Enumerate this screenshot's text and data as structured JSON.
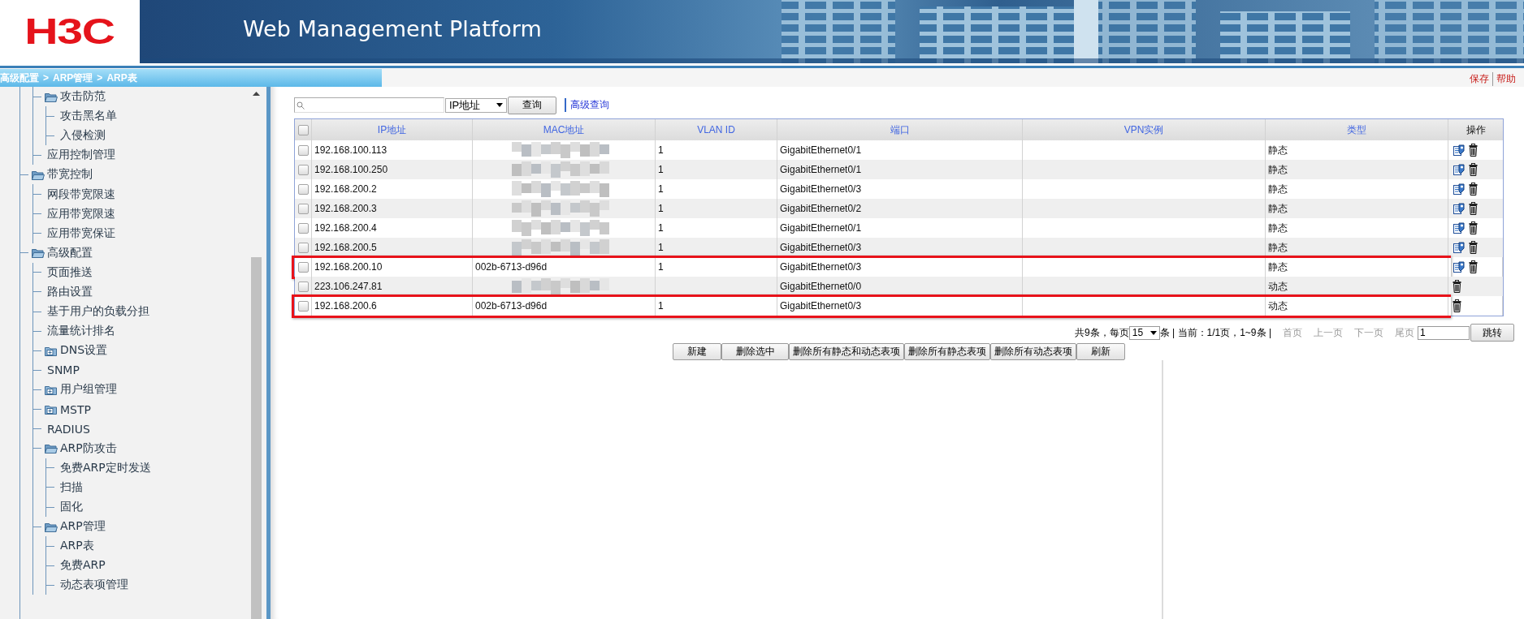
{
  "header": {
    "logo": "H3C",
    "title": "Web Management Platform"
  },
  "breadcrumb": {
    "items": [
      "高级配置",
      "ARP管理",
      "ARP表"
    ],
    "separator": ">"
  },
  "top_links": [
    "保存",
    "帮助"
  ],
  "sidebar": {
    "tree": [
      {
        "kind": "group",
        "children": [
          {
            "label": "攻击防范",
            "kind": "folder",
            "expanded": true,
            "children": [
              {
                "label": "攻击黑名单",
                "kind": "leaf"
              },
              {
                "label": "入侵检测",
                "kind": "leaf"
              }
            ]
          },
          {
            "label": "应用控制管理",
            "kind": "leaf"
          }
        ]
      },
      {
        "label": "带宽控制",
        "kind": "folder",
        "expanded": true,
        "children": [
          {
            "label": "网段带宽限速",
            "kind": "leaf"
          },
          {
            "label": "应用带宽限速",
            "kind": "leaf"
          },
          {
            "label": "应用带宽保证",
            "kind": "leaf"
          }
        ]
      },
      {
        "label": "高级配置",
        "kind": "folder",
        "expanded": true,
        "children": [
          {
            "label": "页面推送",
            "kind": "leaf"
          },
          {
            "label": "路由设置",
            "kind": "leaf"
          },
          {
            "label": "基于用户的负载分担",
            "kind": "leaf"
          },
          {
            "label": "流量统计排名",
            "kind": "leaf"
          },
          {
            "label": "DNS设置",
            "kind": "folder",
            "expanded": false
          },
          {
            "label": "SNMP",
            "kind": "leaf"
          },
          {
            "label": "用户组管理",
            "kind": "folder",
            "expanded": false
          },
          {
            "label": "MSTP",
            "kind": "folder",
            "expanded": false
          },
          {
            "label": "RADIUS",
            "kind": "leaf"
          },
          {
            "label": "ARP防攻击",
            "kind": "folder",
            "expanded": true,
            "children": [
              {
                "label": "免费ARP定时发送",
                "kind": "leaf"
              },
              {
                "label": "扫描",
                "kind": "leaf"
              },
              {
                "label": "固化",
                "kind": "leaf"
              }
            ]
          },
          {
            "label": "ARP管理",
            "kind": "folder",
            "expanded": true,
            "children": [
              {
                "label": "ARP表",
                "kind": "leaf"
              },
              {
                "label": "免费ARP",
                "kind": "leaf"
              },
              {
                "label": "动态表项管理",
                "kind": "leaf"
              }
            ]
          }
        ]
      }
    ]
  },
  "search": {
    "field_type": "IP地址",
    "button": "查询",
    "advanced_link": "高级查询"
  },
  "table": {
    "select_all": {
      "checked": false
    },
    "columns": [
      {
        "label": "IP地址",
        "sortable": true
      },
      {
        "label": "MAC地址",
        "sortable": true
      },
      {
        "label": "VLAN ID",
        "sortable": true
      },
      {
        "label": "端口",
        "sortable": true
      },
      {
        "label": "VPN实例",
        "sortable": true
      },
      {
        "label": "类型",
        "sortable": true
      },
      {
        "label": "操作",
        "sortable": false
      }
    ],
    "rows": [
      {
        "checked": false,
        "ip": "192.168.100.113",
        "mac_redacted": true,
        "vlan": "1",
        "port": "GigabitEthernet0/1",
        "type": "静态",
        "actions": [
          {
            "kind": "edit"
          },
          {
            "kind": "delete"
          }
        ],
        "highlighted": false
      },
      {
        "checked": false,
        "ip": "192.168.100.250",
        "mac_redacted": true,
        "vlan": "1",
        "port": "GigabitEthernet0/1",
        "type": "静态",
        "actions": [
          {
            "kind": "edit"
          },
          {
            "kind": "delete"
          }
        ],
        "highlighted": false
      },
      {
        "checked": false,
        "ip": "192.168.200.2",
        "mac_redacted": true,
        "vlan": "1",
        "port": "GigabitEthernet0/3",
        "type": "静态",
        "actions": [
          {
            "kind": "edit"
          },
          {
            "kind": "delete"
          }
        ],
        "highlighted": false
      },
      {
        "checked": false,
        "ip": "192.168.200.3",
        "mac_redacted": true,
        "vlan": "1",
        "port": "GigabitEthernet0/2",
        "type": "静态",
        "actions": [
          {
            "kind": "edit"
          },
          {
            "kind": "delete"
          }
        ],
        "highlighted": false
      },
      {
        "checked": false,
        "ip": "192.168.200.4",
        "mac_redacted": true,
        "vlan": "1",
        "port": "GigabitEthernet0/1",
        "type": "静态",
        "actions": [
          {
            "kind": "edit"
          },
          {
            "kind": "delete"
          }
        ],
        "highlighted": false
      },
      {
        "checked": false,
        "ip": "192.168.200.5",
        "mac_redacted": true,
        "vlan": "1",
        "port": "GigabitEthernet0/3",
        "type": "静态",
        "actions": [
          {
            "kind": "edit"
          },
          {
            "kind": "delete"
          }
        ],
        "highlighted": false
      },
      {
        "checked": false,
        "ip": "192.168.200.10",
        "mac": "002b-6713-d96d",
        "vlan": "1",
        "port": "GigabitEthernet0/3",
        "type": "静态",
        "actions": [
          {
            "kind": "edit"
          },
          {
            "kind": "delete"
          }
        ],
        "highlighted": true
      },
      {
        "checked": false,
        "ip": "223.106.247.81",
        "mac_redacted": true,
        "port": "GigabitEthernet0/0",
        "type": "动态",
        "actions": [
          {
            "kind": "delete"
          }
        ],
        "highlighted": false
      },
      {
        "checked": false,
        "ip": "192.168.200.6",
        "mac": "002b-6713-d96d",
        "vlan": "1",
        "port": "GigabitEthernet0/3",
        "type": "动态",
        "actions": [
          {
            "kind": "delete"
          }
        ],
        "highlighted": true
      }
    ]
  },
  "pager": {
    "total_text": "共9条，每页",
    "page_size": "15",
    "status_text": "条 | 当前：1/1页，1~9条 |",
    "nav": [
      {
        "label": "首页",
        "disabled": true
      },
      {
        "label": "上一页",
        "disabled": true
      },
      {
        "label": "下一页",
        "disabled": true
      },
      {
        "label": "尾页",
        "disabled": true
      }
    ],
    "page_input": "1",
    "go_button": "跳转"
  },
  "buttons": [
    "新建",
    "删除选中",
    "删除所有静态和动态表项",
    "删除所有静态表项",
    "删除所有动态表项",
    "刷新"
  ]
}
